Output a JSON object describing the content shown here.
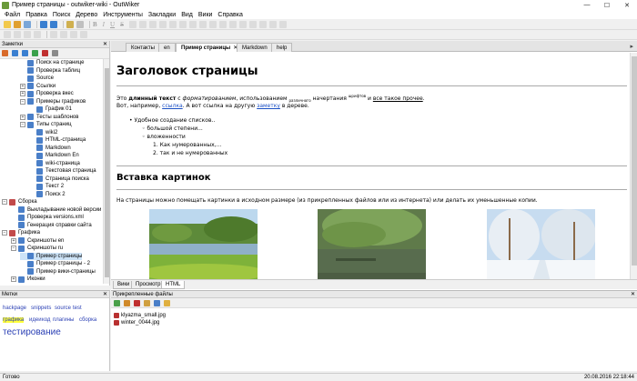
{
  "window": {
    "title": "Пример страницы - outwiker-wiki - OutWiker",
    "minimize": "—",
    "maximize": "☐",
    "close": "✕"
  },
  "menu": [
    "Файл",
    "Правка",
    "Поиск",
    "Дерево",
    "Инструменты",
    "Закладки",
    "Вид",
    "Вики",
    "Справка"
  ],
  "format_toolbar": [
    "B",
    "I",
    "U",
    "S"
  ],
  "left_panel": {
    "title": "Заметки",
    "close": "✕",
    "tree": [
      {
        "label": "Поиск на странице",
        "level": 2,
        "expander": ""
      },
      {
        "label": "Проверка таблиц",
        "level": 2,
        "expander": ""
      },
      {
        "label": "Source",
        "level": 2,
        "expander": ""
      },
      {
        "label": "Ссылки",
        "level": 2,
        "expander": "+"
      },
      {
        "label": "Проверка вкес",
        "level": 2,
        "expander": "+"
      },
      {
        "label": "Примеры графиков",
        "level": 2,
        "expander": "−"
      },
      {
        "label": "График 01",
        "level": 3,
        "expander": ""
      },
      {
        "label": "Тесты шаблонов",
        "level": 2,
        "expander": "+"
      },
      {
        "label": "Типы страниц",
        "level": 2,
        "expander": "−"
      },
      {
        "label": "wiki2",
        "level": 3,
        "expander": ""
      },
      {
        "label": "HTML-страница",
        "level": 3,
        "expander": ""
      },
      {
        "label": "Markdown",
        "level": 3,
        "expander": ""
      },
      {
        "label": "Markdown En",
        "level": 3,
        "expander": ""
      },
      {
        "label": "wiki-страница",
        "level": 3,
        "expander": ""
      },
      {
        "label": "Текстовая страница",
        "level": 3,
        "expander": ""
      },
      {
        "label": "Страница поиска",
        "level": 3,
        "expander": ""
      },
      {
        "label": "Текст 2",
        "level": 3,
        "expander": ""
      },
      {
        "label": "Поиск 2",
        "level": 3,
        "expander": ""
      },
      {
        "label": "Сборка",
        "level": 0,
        "expander": "−"
      },
      {
        "label": "Выкладывание новой версии",
        "level": 1,
        "expander": ""
      },
      {
        "label": "Проверка versions.xml",
        "level": 1,
        "expander": ""
      },
      {
        "label": "Генерация справки сайта",
        "level": 1,
        "expander": ""
      },
      {
        "label": "Графика",
        "level": 0,
        "expander": "−"
      },
      {
        "label": "Скриншоты en",
        "level": 1,
        "expander": "+"
      },
      {
        "label": "Скриншоты ru",
        "level": 1,
        "expander": "−"
      },
      {
        "label": "Пример страницы",
        "level": 2,
        "expander": "",
        "selected": true
      },
      {
        "label": "Пример страницы - 2",
        "level": 2,
        "expander": ""
      },
      {
        "label": "Пример вики-страницы",
        "level": 2,
        "expander": ""
      },
      {
        "label": "Иконки",
        "level": 1,
        "expander": "+"
      }
    ]
  },
  "tabs": [
    {
      "label": "Контакты",
      "active": false
    },
    {
      "label": "en",
      "active": false
    },
    {
      "label": "Пример страницы",
      "active": true
    },
    {
      "label": "Markdown",
      "active": false
    },
    {
      "label": "help",
      "active": false
    }
  ],
  "tab_close": "✕",
  "tabs_more": "▸",
  "doc": {
    "h1": "Заголовок страницы",
    "line1": {
      "p1": "Это ",
      "bold": "длинный текст",
      "p2": " с ",
      "italic": "форматированием",
      "p3": ", использованием ",
      "sub": "различного",
      "p4": " начертания ",
      "sup": "шрифтов",
      "p5": " и ",
      "link": "все такое прочее",
      "p6": "."
    },
    "line2": {
      "p1": "Вот, например, ",
      "link1": "ссылка",
      "p2": ". А вот ссылка на другую ",
      "link2": "заметку",
      "p3": " в дереве."
    },
    "list": [
      {
        "text": "Удобное создание списков..",
        "marker": "•"
      },
      {
        "text": "большой степени...",
        "marker": "◦"
      },
      {
        "text": "вложенности",
        "marker": "◦"
      },
      {
        "text": "Как нумерованных,...",
        "marker": "1."
      },
      {
        "text": "так и не нумерованных",
        "marker": "2."
      }
    ],
    "h2": "Вставка картинок",
    "para": "На страницы можно помещать картинки в исходном размере (из прикрепленных файлов или из интернета) или делать их уменьшенные копии."
  },
  "mode_tabs": [
    "Вики",
    "Просмотр",
    "HTML"
  ],
  "tags_panel": {
    "title": "Метки",
    "close": "✕",
    "tags": [
      "hackpage",
      "snippets",
      "source",
      "test",
      "графика",
      "идеи",
      "код",
      "плагины",
      "сборка",
      "тестирование"
    ]
  },
  "attach_panel": {
    "title": "Прикрепленные файлы",
    "close": "✕",
    "files": [
      "klyazma_small.jpg",
      "winter_0044.jpg"
    ]
  },
  "status": {
    "left": "Готово",
    "right": "20.08.2016 22:18:44"
  },
  "colors": {
    "link": "#1a4fc4",
    "tag": "#2a3fb4",
    "selected_tag_bg": "#ffff3a",
    "selection": "#cde3f7"
  }
}
